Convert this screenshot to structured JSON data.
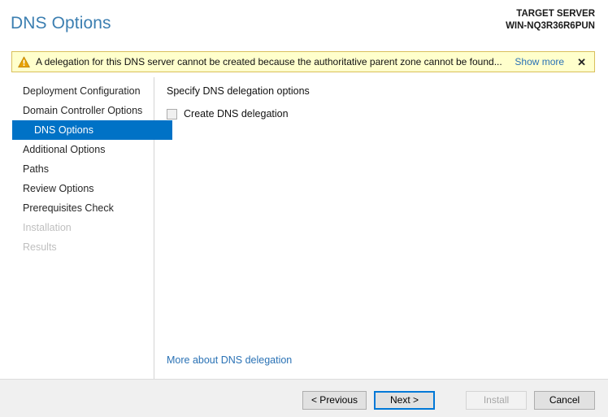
{
  "header": {
    "title": "DNS Options",
    "target_label": "TARGET SERVER",
    "target_name": "WIN-NQ3R36R6PUN"
  },
  "warning": {
    "icon": "warning-triangle-icon",
    "message": "A delegation for this DNS server cannot be created because the authoritative parent zone cannot be found...",
    "show_more_label": "Show more",
    "close_label": "✕"
  },
  "sidebar": {
    "items": [
      {
        "label": "Deployment Configuration",
        "state": "normal"
      },
      {
        "label": "Domain Controller Options",
        "state": "normal"
      },
      {
        "label": "DNS Options",
        "state": "selected"
      },
      {
        "label": "Additional Options",
        "state": "normal"
      },
      {
        "label": "Paths",
        "state": "normal"
      },
      {
        "label": "Review Options",
        "state": "normal"
      },
      {
        "label": "Prerequisites Check",
        "state": "normal"
      },
      {
        "label": "Installation",
        "state": "disabled"
      },
      {
        "label": "Results",
        "state": "disabled"
      }
    ]
  },
  "main": {
    "heading": "Specify DNS delegation options",
    "checkbox": {
      "label": "Create DNS delegation",
      "checked": false,
      "enabled": false
    },
    "more_link": "More about DNS delegation"
  },
  "footer": {
    "buttons": [
      {
        "label": "< Previous",
        "state": "normal"
      },
      {
        "label": "Next >",
        "state": "default"
      },
      {
        "label": "Install",
        "state": "disabled"
      },
      {
        "label": "Cancel",
        "state": "normal"
      }
    ]
  },
  "colors": {
    "accent_blue": "#0072c6",
    "title_blue": "#3c7fb1",
    "link_blue": "#2a72b5",
    "warning_bg": "#ffffcc",
    "warning_border": "#d9bf5b",
    "warning_icon": "#e8a200",
    "footer_bg": "#f0f0f0",
    "focus_border": "#0078d7"
  }
}
